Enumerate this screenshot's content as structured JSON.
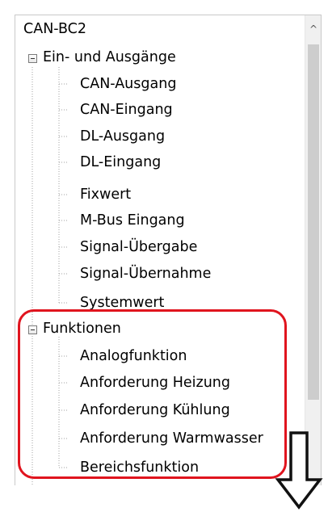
{
  "tree": {
    "root": "CAN-BC2",
    "groups": [
      {
        "label": "Ein- und Ausgänge",
        "items": [
          "CAN-Ausgang",
          "CAN-Eingang",
          "DL-Ausgang",
          "DL-Eingang",
          "Fixwert",
          "M-Bus Eingang",
          "Signal-Übergabe",
          "Signal-Übernahme",
          "Systemwert"
        ]
      },
      {
        "label": "Funktionen",
        "items": [
          "Analogfunktion",
          "Anforderung Heizung",
          "Anforderung Kühlung",
          "Anforderung Warmwasser",
          "Bereichsfunktion"
        ]
      }
    ]
  },
  "scrollbar": {
    "up_arrow": "^"
  },
  "annotations": {
    "highlight_color": "#e0141e",
    "arrow_direction": "down"
  }
}
